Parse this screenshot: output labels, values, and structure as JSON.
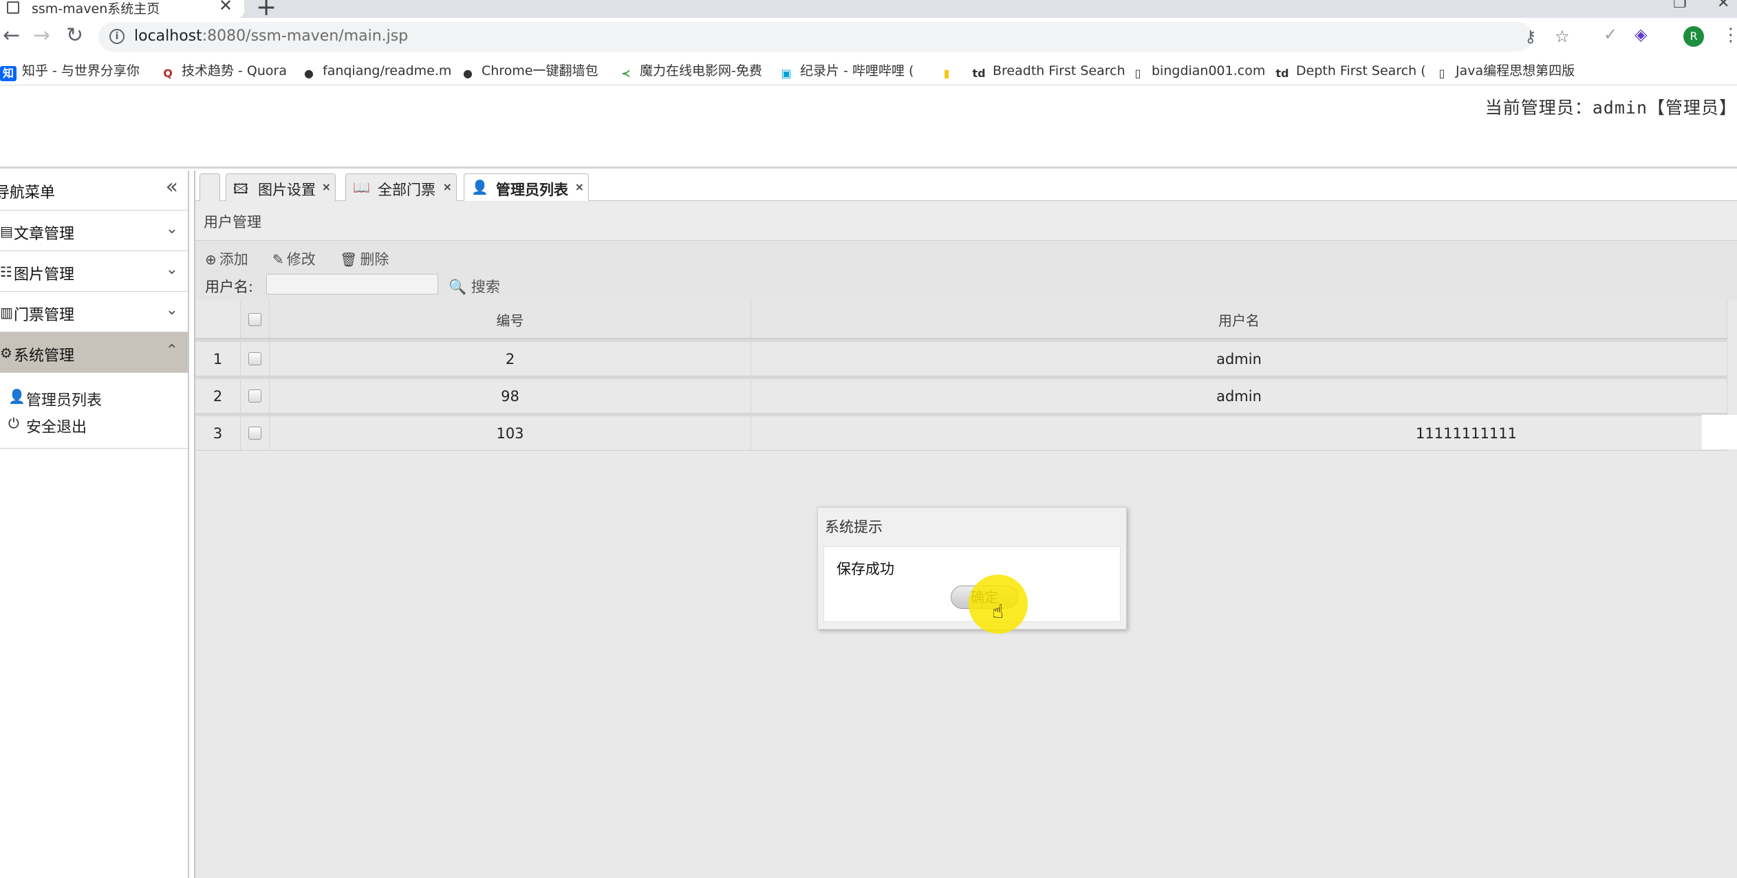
{
  "browser": {
    "tab_title": "ssm-maven系统主页",
    "tab_close": "✕",
    "new_tab": "+",
    "url_host": "localhost",
    "url_path": ":8080/ssm-maven/main.jsp",
    "bookmarks": [
      {
        "icon": "知",
        "label": "知乎 - 与世界分享你",
        "color": "#0066ff"
      },
      {
        "icon": "Q",
        "label": "技术趋势 - Quora",
        "color": "#b92b27"
      },
      {
        "icon": "●",
        "label": "fanqiang/readme.m",
        "color": "#111111"
      },
      {
        "icon": "●",
        "label": "Chrome一键翻墙包",
        "color": "#111111"
      },
      {
        "icon": "≺",
        "label": "魔力在线电影网-免费",
        "color": "#3b9a3b"
      },
      {
        "icon": "▣",
        "label": "纪录片 - 哔哩哔哩 (",
        "color": "#00a1d6"
      },
      {
        "icon": "▮",
        "label": "",
        "color": "#f5c518"
      },
      {
        "icon": "td",
        "label": "Breadth First Search",
        "color": "#333333"
      },
      {
        "icon": "▯",
        "label": "bingdian001.com",
        "color": "#555555"
      },
      {
        "icon": "td",
        "label": "Depth First Search (",
        "color": "#333333"
      },
      {
        "icon": "▯",
        "label": "Java编程思想第四版",
        "color": "#555555"
      }
    ]
  },
  "header": {
    "current_admin": "当前管理员：admin【管理员】"
  },
  "sidebar": {
    "title": "导航菜单",
    "collapse_icon": "«",
    "sections": [
      {
        "label": "文章管理",
        "icon": "▤",
        "chevron": "⌄"
      },
      {
        "label": "图片管理",
        "icon": "☷",
        "chevron": "⌄"
      },
      {
        "label": "门票管理",
        "icon": "▥",
        "chevron": "⌄"
      },
      {
        "label": "系统管理",
        "icon": "⚙",
        "chevron": "⌃"
      }
    ],
    "sub_items": [
      {
        "label": "管理员列表",
        "icon": "👤"
      },
      {
        "label": "安全退出",
        "icon": "⏻"
      }
    ]
  },
  "tabs": [
    {
      "label": "",
      "icon": ""
    },
    {
      "label": "图片设置",
      "icon": "🖾",
      "close": "×"
    },
    {
      "label": "全部门票",
      "icon": "📖",
      "close": "×"
    },
    {
      "label": "管理员列表",
      "icon": "👤",
      "close": "×"
    }
  ],
  "panel": {
    "title": "用户管理",
    "toolbar": {
      "add": "添加",
      "edit": "修改",
      "delete": "删除",
      "username_label": "用户名:",
      "username_value": "",
      "search": "搜索"
    }
  },
  "grid": {
    "columns": {
      "id": "编号",
      "username": "用户名"
    },
    "rows": [
      {
        "num": "1",
        "id": "2",
        "username": "admin"
      },
      {
        "num": "2",
        "id": "98",
        "username": "admin"
      },
      {
        "num": "3",
        "id": "103",
        "username": "11111111111"
      }
    ]
  },
  "dialog": {
    "title": "系统提示",
    "message": "保存成功",
    "ok": "确定"
  },
  "colors": {
    "cursor_highlight": "#fae600",
    "active_menu": "#c7c3bb",
    "profile": "#1e8e3e"
  }
}
